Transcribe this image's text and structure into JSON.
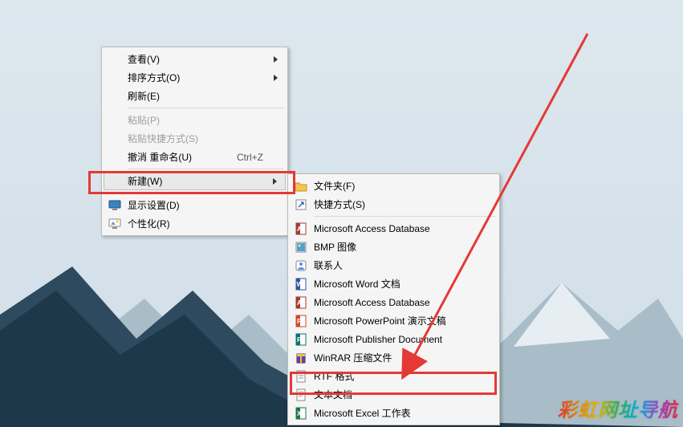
{
  "menu1": {
    "view": "查看(V)",
    "sort": "排序方式(O)",
    "refresh": "刷新(E)",
    "paste": "粘贴(P)",
    "pasteShortcut": "粘贴快捷方式(S)",
    "undoRename": "撤消 重命名(U)",
    "undoShortcut": "Ctrl+Z",
    "new": "新建(W)",
    "displaySettings": "显示设置(D)",
    "personalize": "个性化(R)"
  },
  "menu2": {
    "folder": "文件夹(F)",
    "shortcut": "快捷方式(S)",
    "access1": "Microsoft Access Database",
    "bmp": "BMP 图像",
    "contact": "联系人",
    "word": "Microsoft Word 文档",
    "access2": "Microsoft Access Database",
    "ppt": "Microsoft PowerPoint 演示文稿",
    "publisher": "Microsoft Publisher Document",
    "winrar": "WinRAR 压缩文件",
    "rtf": "RTF 格式",
    "txt": "文本文档",
    "excel": "Microsoft Excel 工作表"
  },
  "watermark": "彩虹网址导航"
}
